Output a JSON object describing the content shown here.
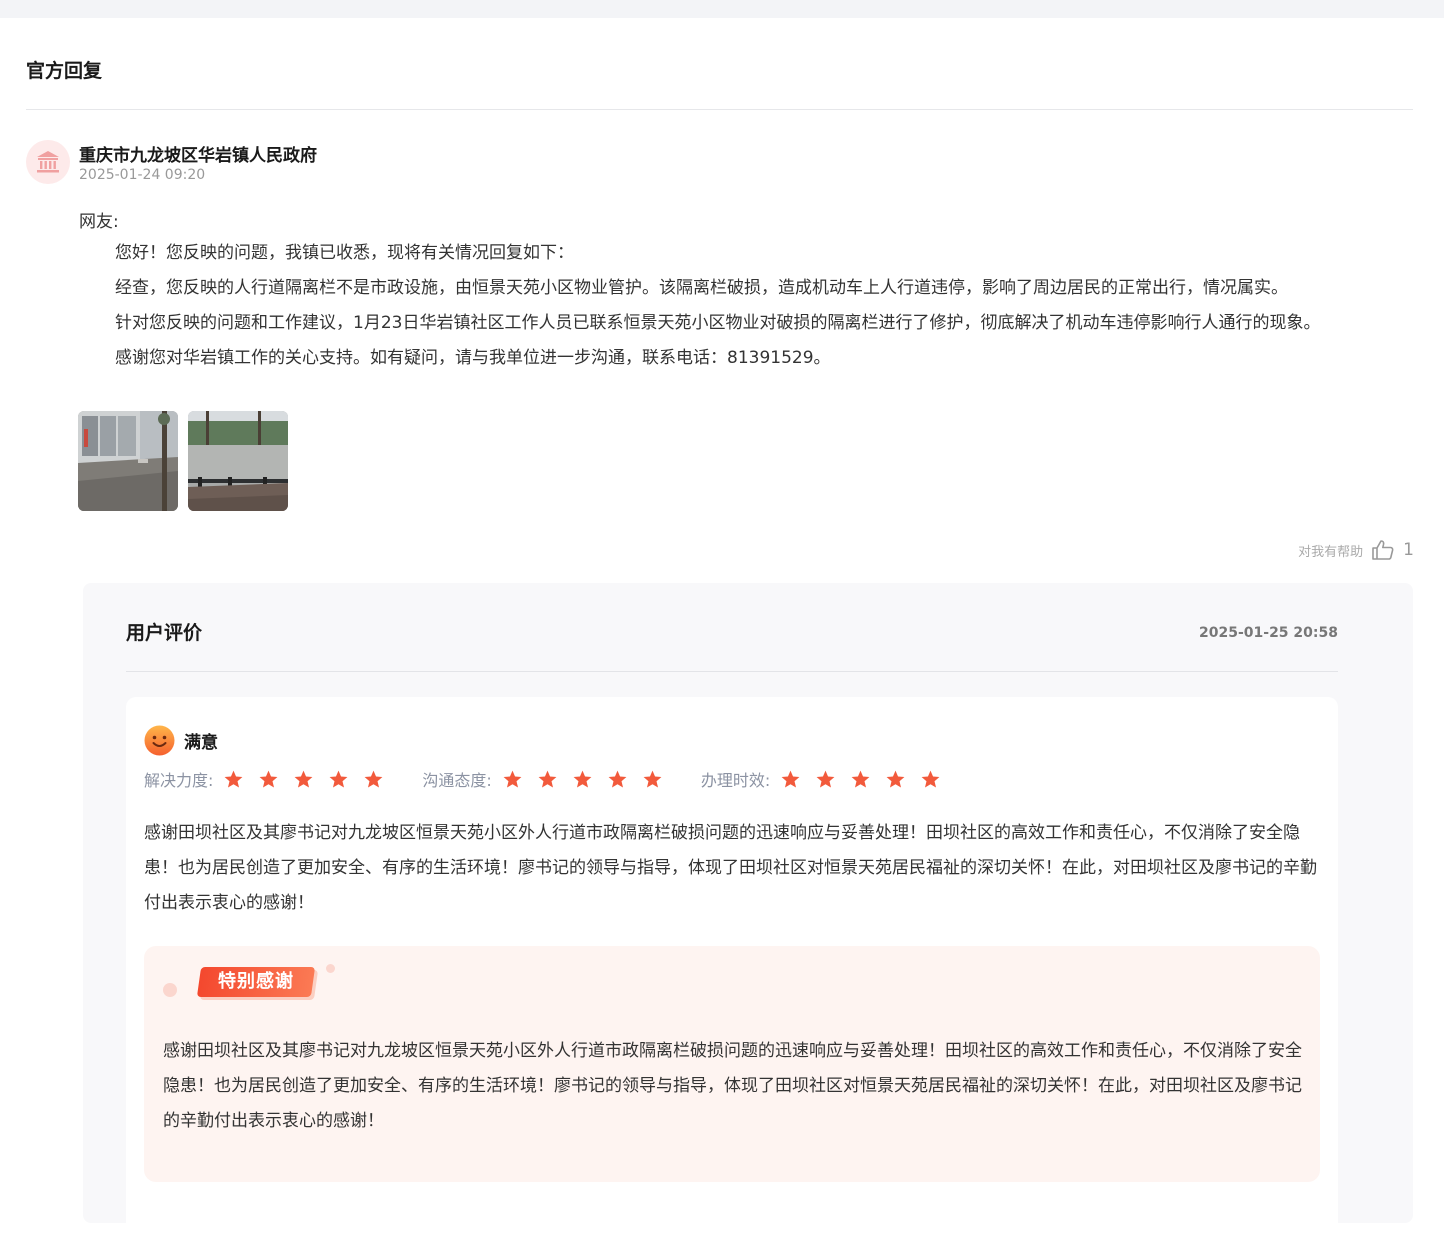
{
  "official_reply": {
    "section_title": "官方回复",
    "org_name": "重庆市九龙坡区华岩镇人民政府",
    "time": "2025-01-24 09:20",
    "greeting": "网友:",
    "paragraphs": [
      "您好！您反映的问题，我镇已收悉，现将有关情况回复如下：",
      "经查，您反映的人行道隔离栏不是市政设施，由恒景天苑小区物业管护。该隔离栏破损，造成机动车上人行道违停，影响了周边居民的正常出行，情况属实。",
      "针对您反映的问题和工作建议，1月23日华岩镇社区工作人员已联系恒景天苑小区物业对破损的隔离栏进行了修护，彻底解决了机动车违停影响行人通行的现象。",
      "感谢您对华岩镇工作的关心支持。如有疑问，请与我单位进一步沟通，联系电话：81391529。"
    ],
    "helpful_label": "对我有帮助",
    "helpful_count": "1"
  },
  "evaluation": {
    "title": "用户评价",
    "time": "2025-01-25 20:58",
    "satisfaction": "满意",
    "ratings": [
      {
        "label": "解决力度:",
        "stars": 5
      },
      {
        "label": "沟通态度:",
        "stars": 5
      },
      {
        "label": "办理时效:",
        "stars": 5
      }
    ],
    "comment": "感谢田坝社区及其廖书记对九龙坡区恒景天苑小区外人行道市政隔离栏破损问题的迅速响应与妥善处理！田坝社区的高效工作和责任心，不仅消除了安全隐患！也为居民创造了更加安全、有序的生活环境！廖书记的领导与指导，体现了田坝社区对恒景天苑居民福祉的深切关怀！在此，对田坝社区及廖书记的辛勤付出表示衷心的感谢！",
    "special_thanks_badge": "特别感谢",
    "special_thanks_text": "感谢田坝社区及其廖书记对九龙坡区恒景天苑小区外人行道市政隔离栏破损问题的迅速响应与妥善处理！田坝社区的高效工作和责任心，不仅消除了安全隐患！也为居民创造了更加安全、有序的生活环境！廖书记的领导与指导，体现了田坝社区对恒景天苑居民福祉的深切关怀！在此，对田坝社区及廖书记的辛勤付出表示衷心的感谢！"
  },
  "colors": {
    "accent_red": "#f4482e",
    "star": "#f25a3c",
    "thanks_bg": "#fef4f1"
  },
  "icons": {
    "org_avatar": "government-building-icon",
    "helpful": "thumbs-up-icon",
    "satisfaction": "smiley-face-icon",
    "rating": "star-icon"
  }
}
